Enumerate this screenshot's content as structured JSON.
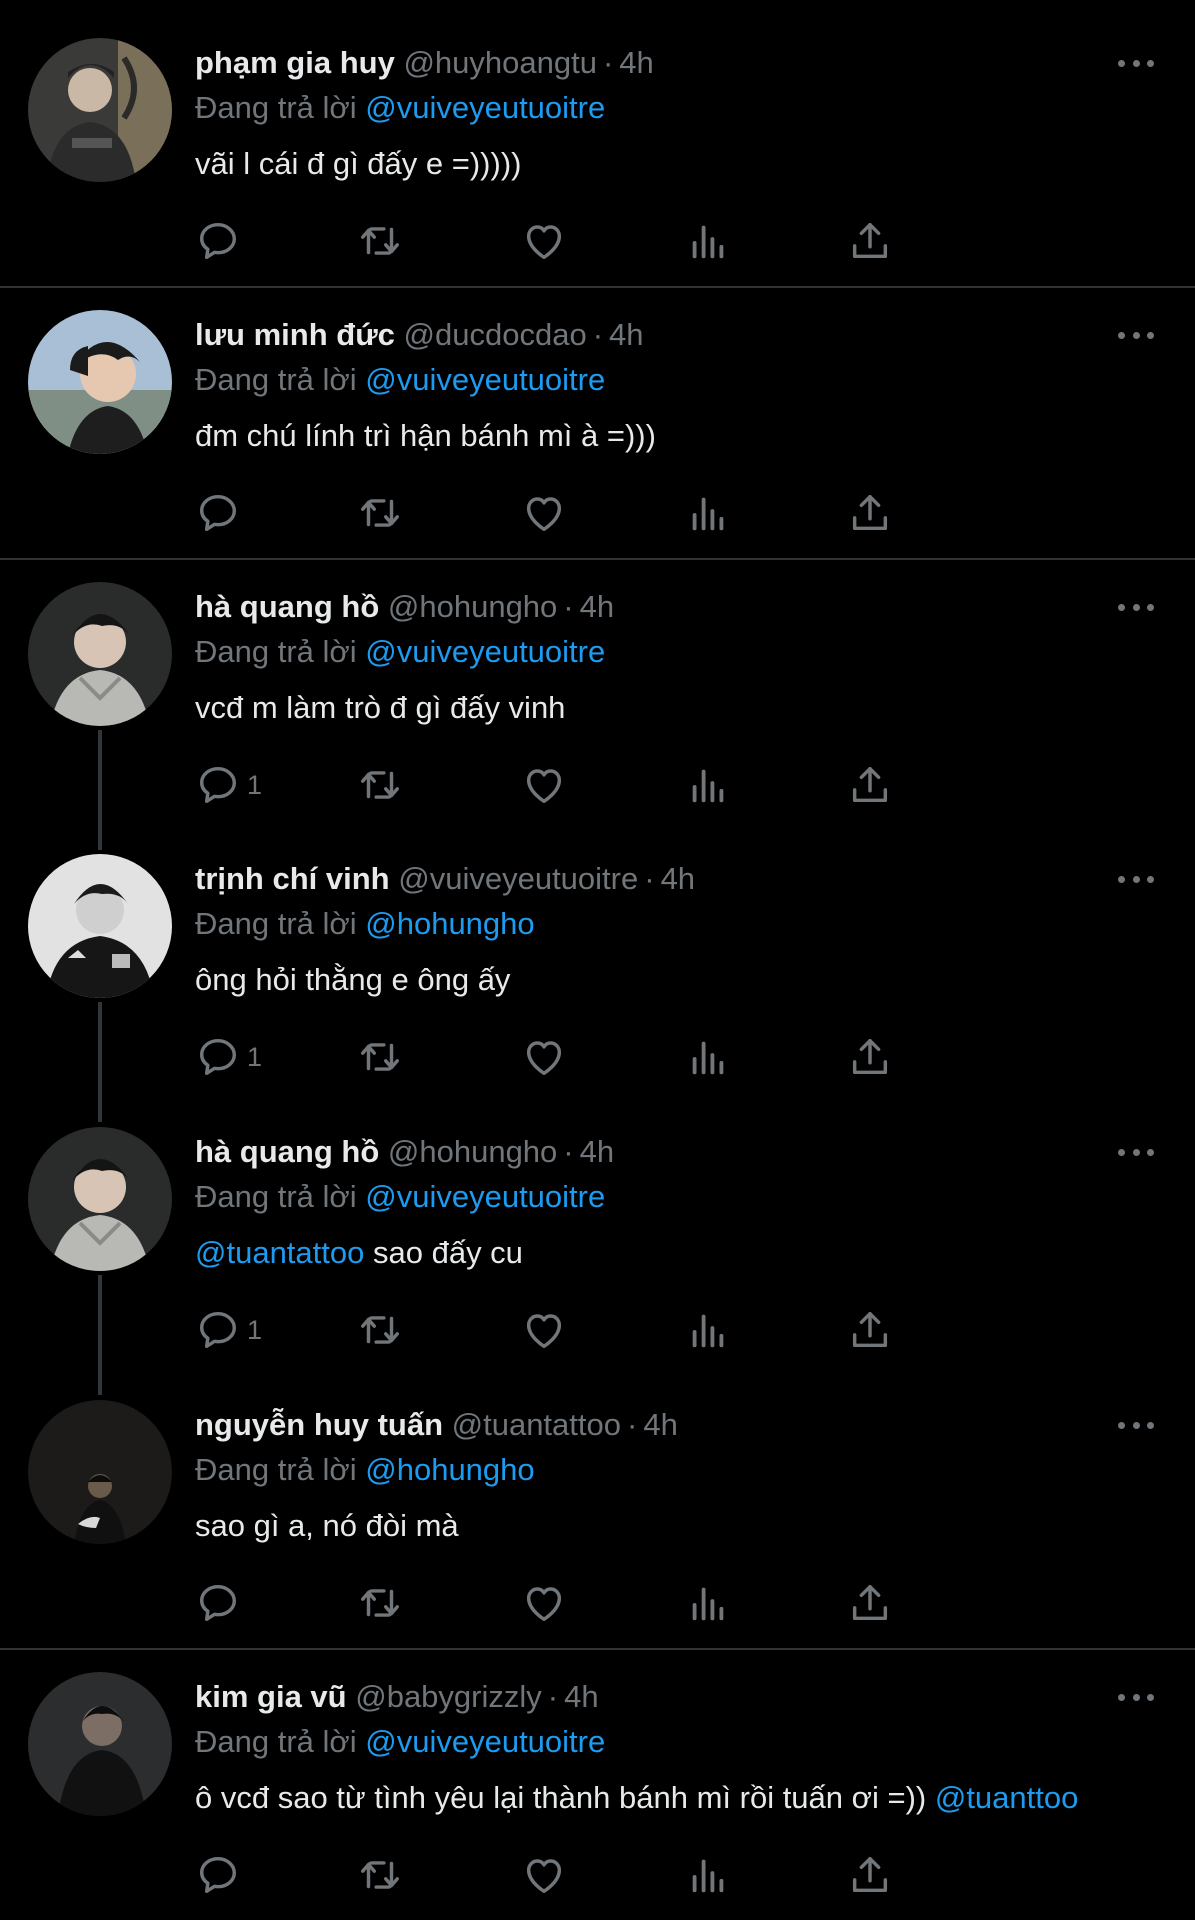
{
  "tweets": [
    {
      "name": "phạm gia huy",
      "handle": "@huyhoangtu",
      "time": "4h",
      "reply_prefix": "Đang trả lời",
      "reply_to": "@vuiveyeutuoitre",
      "mention": "",
      "text": "vãi l cái đ gì đấy e =)))))",
      "trailing_mention": "",
      "reply_count": ""
    },
    {
      "name": "lưu minh đức",
      "handle": "@ducdocdao",
      "time": "4h",
      "reply_prefix": "Đang trả lời",
      "reply_to": "@vuiveyeutuoitre",
      "mention": "",
      "text": "đm chú lính trì hận bánh mì à =)))",
      "trailing_mention": "",
      "reply_count": ""
    },
    {
      "name": "hà quang hồ",
      "handle": "@hohungho",
      "time": "4h",
      "reply_prefix": "Đang trả lời",
      "reply_to": "@vuiveyeutuoitre",
      "mention": "",
      "text": "vcđ m làm trò đ gì đấy vinh",
      "trailing_mention": "",
      "reply_count": "1"
    },
    {
      "name": "trịnh chí vinh",
      "handle": "@vuiveyeutuoitre",
      "time": "4h",
      "reply_prefix": "Đang trả lời",
      "reply_to": "@hohungho",
      "mention": "",
      "text": "ông hỏi thằng e ông ấy",
      "trailing_mention": "",
      "reply_count": "1"
    },
    {
      "name": "hà quang hồ",
      "handle": "@hohungho",
      "time": "4h",
      "reply_prefix": "Đang trả lời",
      "reply_to": "@vuiveyeutuoitre",
      "mention": "@tuantattoo",
      "text": " sao đấy cu",
      "trailing_mention": "",
      "reply_count": "1"
    },
    {
      "name": "nguyễn huy tuấn",
      "handle": "@tuantattoo",
      "time": "4h",
      "reply_prefix": "Đang trả lời",
      "reply_to": "@hohungho",
      "mention": "",
      "text": "sao gì a, nó đòi mà",
      "trailing_mention": "",
      "reply_count": ""
    },
    {
      "name": "kim gia vũ",
      "handle": "@babygrizzly",
      "time": "4h",
      "reply_prefix": "Đang trả lời",
      "reply_to": "@vuiveyeutuoitre",
      "mention": "",
      "text": "ô vcđ sao từ tình yêu lại thành bánh mì rồi tuấn ơi =)) ",
      "trailing_mention": "@tuanttoo",
      "reply_count": ""
    }
  ],
  "icons": {
    "reply": "reply-icon",
    "retweet": "retweet-icon",
    "like": "like-icon",
    "views": "views-icon",
    "share": "share-icon",
    "more": "more-icon"
  },
  "colors": {
    "background": "#000000",
    "text": "#e7e9ea",
    "secondary": "#71767b",
    "mention": "#1d9bf0",
    "divider": "#2f3336"
  }
}
